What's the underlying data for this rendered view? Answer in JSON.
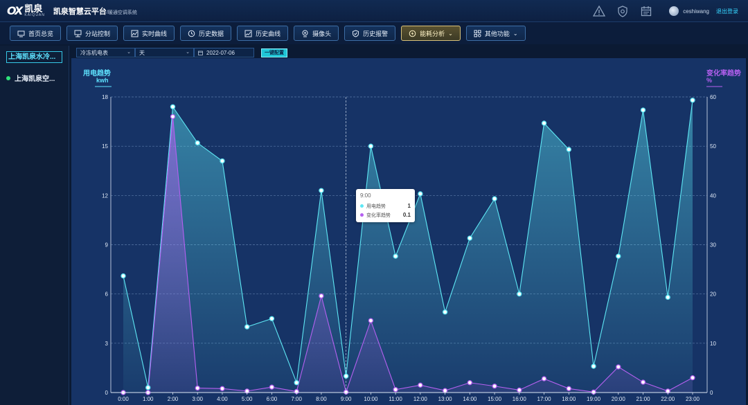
{
  "header": {
    "logo_mark": "OX",
    "logo_cn": "凯泉",
    "logo_en": "KAIQUAN",
    "title": "凯泉智慧云平台",
    "subtitle": "/暖通空调系统",
    "username": "ceshiwang",
    "logout": "退出登录",
    "icons": [
      "warning-icon",
      "shield-icon",
      "calendar-icon",
      "avatar-icon"
    ]
  },
  "nav": {
    "items": [
      {
        "label": "首页总览",
        "icon": "monitor-icon"
      },
      {
        "label": "分站控制",
        "icon": "network-icon"
      },
      {
        "label": "实时曲线",
        "icon": "realtime-chart-icon"
      },
      {
        "label": "历史数据",
        "icon": "history-clock-icon"
      },
      {
        "label": "历史曲线",
        "icon": "line-chart-icon"
      },
      {
        "label": "摄像头",
        "icon": "camera-icon"
      },
      {
        "label": "历史报警",
        "icon": "alarm-shield-icon"
      },
      {
        "label": "能耗分析",
        "icon": "energy-icon",
        "active": true,
        "dropdown": true
      },
      {
        "label": "其他功能",
        "icon": "grid-icon",
        "dropdown": true
      }
    ]
  },
  "sidebar": {
    "selected": "上海凯泉水冷...",
    "items": [
      {
        "label": "上海凯泉空...",
        "status": "online"
      }
    ]
  },
  "filters": {
    "meter": "冷冻机电表",
    "period": "天",
    "date": "2022-07-06",
    "button": "一键配置"
  },
  "tooltip": {
    "title": "9:00",
    "rows": [
      {
        "name": "用电趋势",
        "value": "1"
      },
      {
        "name": "变化率趋势",
        "value": "0.1"
      }
    ]
  },
  "chart_data": {
    "type": "area",
    "x": [
      "0:00",
      "1:00",
      "2:00",
      "3:00",
      "4:00",
      "5:00",
      "6:00",
      "7:00",
      "8:00",
      "9:00",
      "10:00",
      "11:00",
      "12:00",
      "13:00",
      "14:00",
      "15:00",
      "16:00",
      "17:00",
      "18:00",
      "19:00",
      "20:00",
      "21:00",
      "22:00",
      "23:00"
    ],
    "left_axis": {
      "title": "用电趋势",
      "unit": "kwh",
      "ylim": [
        0,
        18
      ],
      "ticks": [
        0,
        3,
        6,
        9,
        12,
        15,
        18
      ]
    },
    "right_axis": {
      "title": "变化率趋势",
      "unit": "%",
      "ylim": [
        0,
        60
      ],
      "ticks": [
        0,
        10,
        20,
        30,
        40,
        50,
        60
      ]
    },
    "series": [
      {
        "name": "用电趋势",
        "axis": "left",
        "color": "#5ee8f5",
        "values": [
          7.1,
          0.3,
          17.4,
          15.2,
          14.1,
          4.0,
          4.5,
          0.6,
          12.3,
          1.0,
          15.0,
          8.3,
          12.1,
          4.9,
          9.4,
          11.8,
          6.0,
          16.4,
          14.8,
          1.6,
          8.3,
          17.2,
          5.8,
          17.8
        ]
      },
      {
        "name": "变化率趋势",
        "axis": "right",
        "color": "#b560f0",
        "values": [
          0,
          0,
          56,
          0.9,
          0.8,
          0.3,
          1.1,
          0.2,
          19.6,
          0.1,
          14.6,
          0.6,
          1.5,
          0.4,
          2.0,
          1.3,
          0.5,
          2.8,
          0.8,
          0.1,
          5.2,
          2.1,
          0.3,
          3.0
        ]
      }
    ],
    "crosshair_x": "9:00",
    "grid": true
  }
}
